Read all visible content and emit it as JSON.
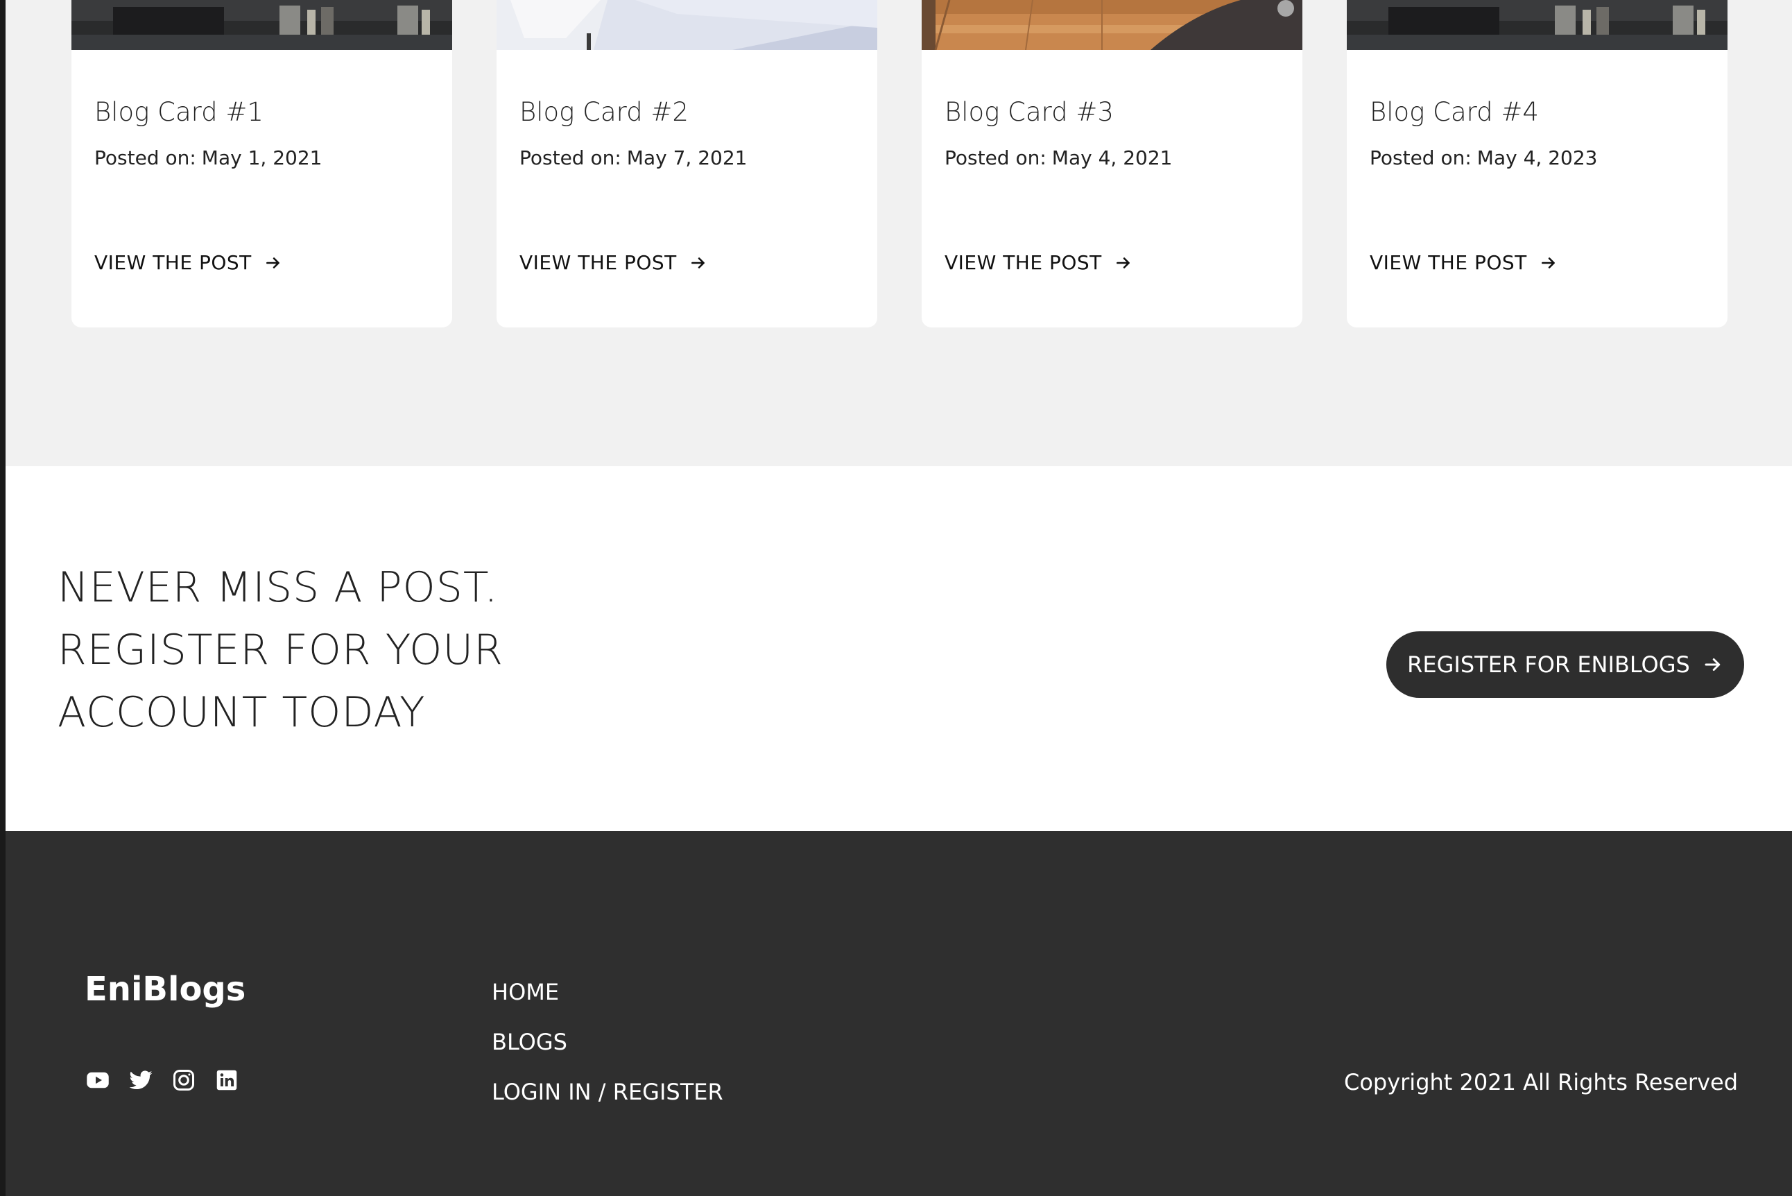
{
  "cards": [
    {
      "title": "Blog Card #1",
      "date_label": "Posted on:",
      "date": "May 1, 2021",
      "link_label": "VIEW THE POST",
      "image": "dark-equipment-photo"
    },
    {
      "title": "Blog Card #2",
      "date_label": "Posted on:",
      "date": "May 7, 2021",
      "link_label": "VIEW THE POST",
      "image": "white-chair-photo"
    },
    {
      "title": "Blog Card #3",
      "date_label": "Posted on:",
      "date": "May 4, 2021",
      "link_label": "VIEW THE POST",
      "image": "wood-floor-photo"
    },
    {
      "title": "Blog Card #4",
      "date_label": "Posted on:",
      "date": "May 4, 2023",
      "link_label": "VIEW THE POST",
      "image": "dark-equipment-photo"
    }
  ],
  "cta": {
    "lines": [
      "NEVER MISS A POST.",
      "REGISTER FOR YOUR",
      "ACCOUNT TODAY"
    ],
    "button_label": "REGISTER FOR ENIBLOGS"
  },
  "footer": {
    "brand": "EniBlogs",
    "social_icons": [
      "youtube-icon",
      "twitter-icon",
      "instagram-icon",
      "linkedin-icon"
    ],
    "nav": [
      "HOME",
      "BLOGS",
      "LOGIN IN / REGISTER"
    ],
    "copyright": "Copyright 2021 All Rights Reserved"
  },
  "colors": {
    "page_bg": "#f1f1f1",
    "card_bg": "#ffffff",
    "footer_bg": "#2f2f2f",
    "button_bg": "#2e2e2e"
  }
}
